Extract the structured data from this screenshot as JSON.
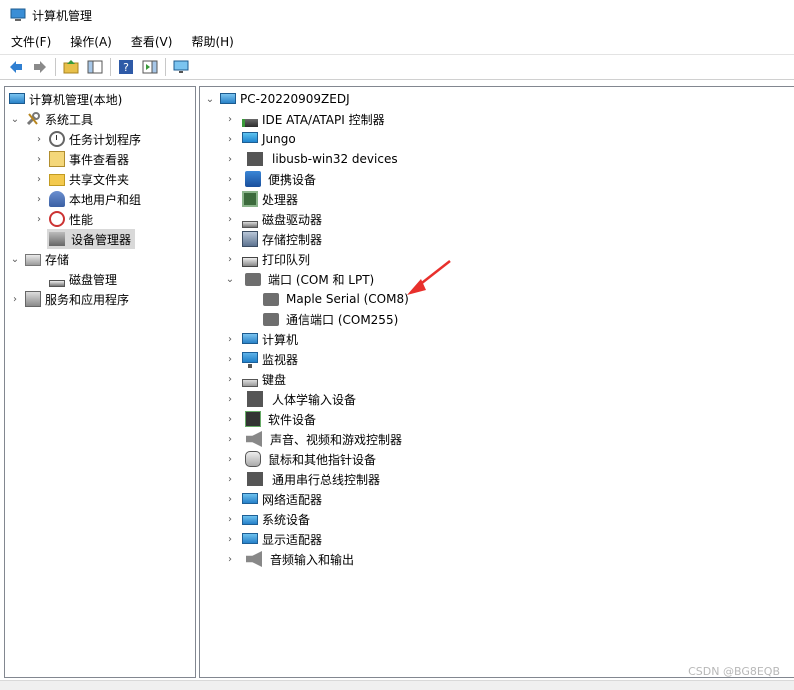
{
  "window": {
    "title": "计算机管理"
  },
  "menu": [
    "文件(F)",
    "操作(A)",
    "查看(V)",
    "帮助(H)"
  ],
  "toolbar": {
    "buttons": [
      "back-icon",
      "forward-icon",
      "up-folder-icon",
      "show-hide-tree-icon",
      "help-icon",
      "action-pane-icon",
      "monitor-icon"
    ]
  },
  "left_tree": {
    "root": "计算机管理(本地)",
    "system_tools": "系统工具",
    "task_scheduler": "任务计划程序",
    "event_viewer": "事件查看器",
    "shared_folders": "共享文件夹",
    "local_users": "本地用户和组",
    "performance": "性能",
    "device_manager": "设备管理器",
    "storage": "存储",
    "disk_management": "磁盘管理",
    "services_apps": "服务和应用程序"
  },
  "device_tree": {
    "computer_name": "PC-20220909ZEDJ",
    "categories": [
      "IDE ATA/ATAPI 控制器",
      "Jungo",
      "libusb-win32 devices",
      "便携设备",
      "处理器",
      "磁盘驱动器",
      "存储控制器",
      "打印队列",
      "端口 (COM 和 LPT)",
      "计算机",
      "监视器",
      "键盘",
      "人体学输入设备",
      "软件设备",
      "声音、视频和游戏控制器",
      "鼠标和其他指针设备",
      "通用串行总线控制器",
      "网络适配器",
      "系统设备",
      "显示适配器",
      "音频输入和输出"
    ],
    "ports_children": [
      "Maple Serial (COM8)",
      "通信端口 (COM255)"
    ]
  },
  "watermark": "CSDN @BG8EQB",
  "colors": {
    "arrow": "#e8302c",
    "selected": "#d9d9d9"
  }
}
